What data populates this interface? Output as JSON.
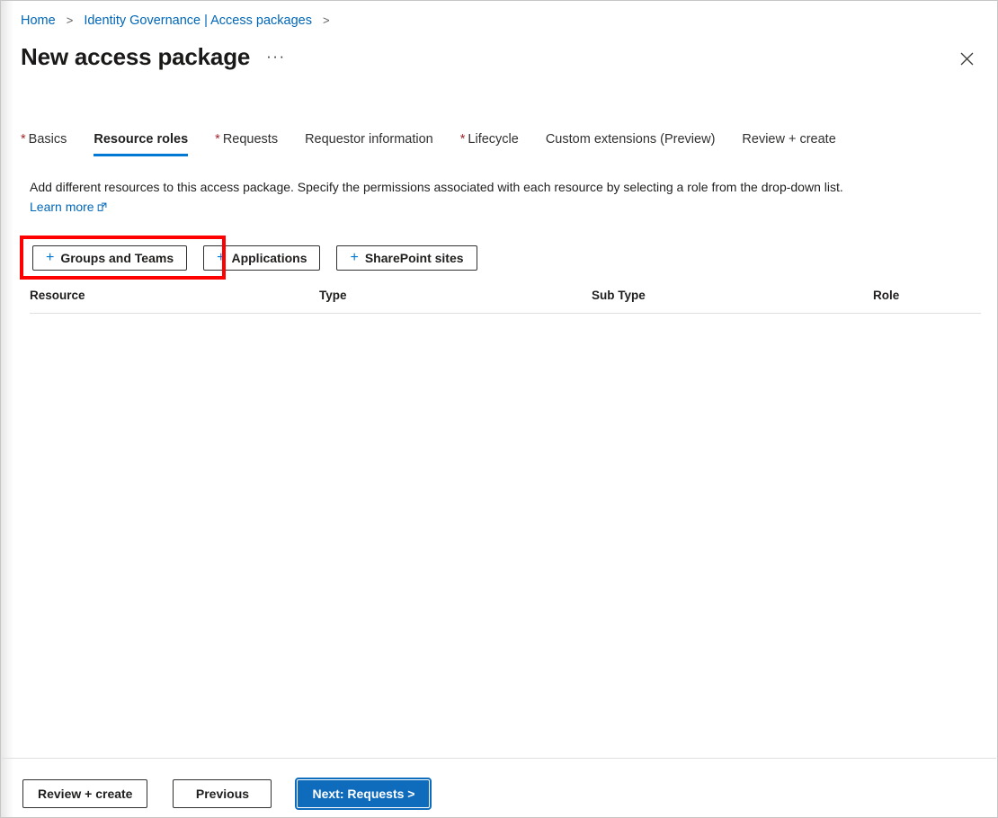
{
  "breadcrumb": {
    "items": [
      {
        "label": "Home"
      },
      {
        "label": "Identity Governance | Access packages"
      }
    ],
    "separator": ">"
  },
  "header": {
    "title": "New access package",
    "ellipsis": "···",
    "close_icon": "close-icon"
  },
  "tabs": [
    {
      "label": "Basics",
      "required": true,
      "selected": false
    },
    {
      "label": "Resource roles",
      "required": false,
      "selected": true
    },
    {
      "label": "Requests",
      "required": true,
      "selected": false
    },
    {
      "label": "Requestor information",
      "required": false,
      "selected": false
    },
    {
      "label": "Lifecycle",
      "required": true,
      "selected": false
    },
    {
      "label": "Custom extensions (Preview)",
      "required": false,
      "selected": false
    },
    {
      "label": "Review + create",
      "required": false,
      "selected": false
    }
  ],
  "required_marker": "*",
  "description": {
    "text": "Add different resources to this access package. Specify the permissions associated with each resource by selecting a role from the drop-down list.",
    "learn_more": "Learn more"
  },
  "add_buttons": [
    {
      "label": "Groups and Teams",
      "plus": "+",
      "highlighted": true
    },
    {
      "label": "Applications",
      "plus": "+",
      "highlighted": false
    },
    {
      "label": "SharePoint sites",
      "plus": "+",
      "highlighted": false
    }
  ],
  "resource_table": {
    "columns": [
      "Resource",
      "Type",
      "Sub Type",
      "Role"
    ],
    "rows": []
  },
  "footer": {
    "review_create": "Review + create",
    "previous": "Previous",
    "next": "Next: Requests >"
  },
  "colors": {
    "accent_blue": "#0078d4",
    "link_blue": "#0067b8",
    "primary_button": "#0f6cbd",
    "required_red": "#a4262c",
    "highlight_red": "#ff0000",
    "text": "#201f1e",
    "border": "#c8c6c4"
  }
}
